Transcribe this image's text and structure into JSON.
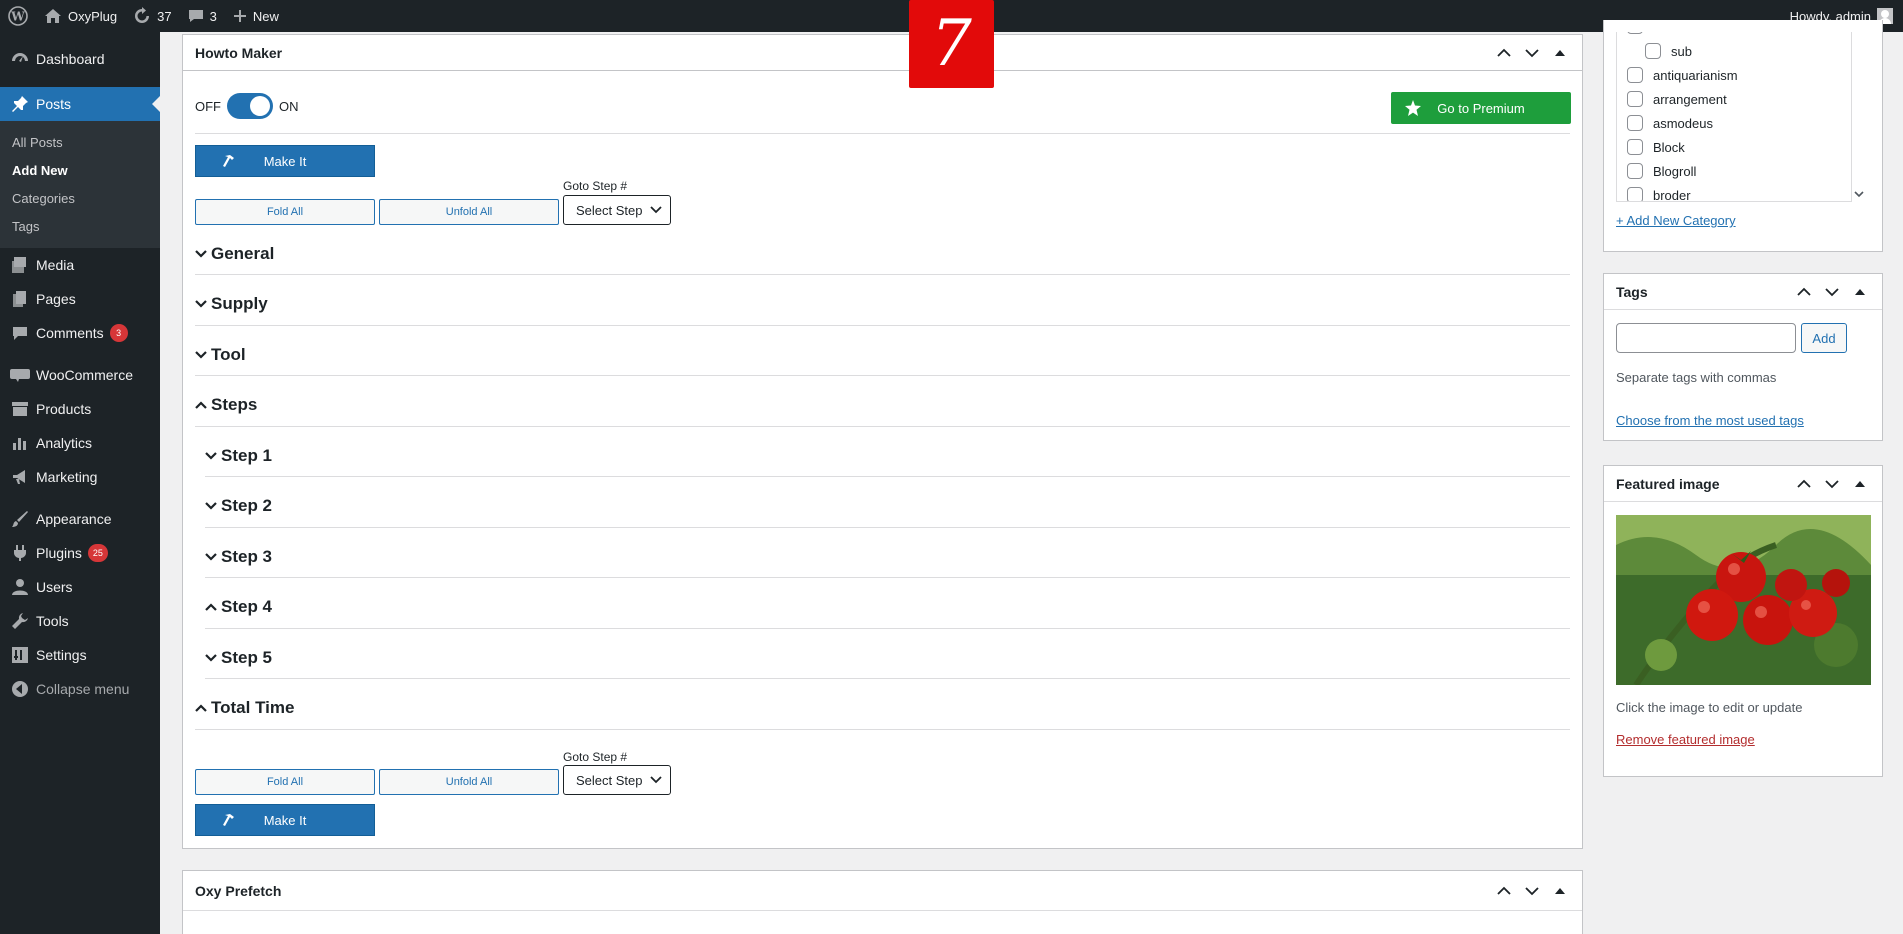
{
  "adminbar": {
    "site_name": "OxyPlug",
    "updates_count": "37",
    "comments_count": "3",
    "new_label": "New",
    "greeting": "Howdy, admin"
  },
  "sidebar": {
    "items": [
      {
        "label": "Dashboard",
        "icon": "dashboard-icon"
      },
      {
        "label": "Posts",
        "icon": "pin-icon"
      },
      {
        "label": "Media",
        "icon": "media-icon"
      },
      {
        "label": "Pages",
        "icon": "pages-icon"
      },
      {
        "label": "Comments",
        "icon": "comment-icon",
        "badge": "3"
      },
      {
        "label": "WooCommerce",
        "icon": "woo-icon"
      },
      {
        "label": "Products",
        "icon": "archive-icon"
      },
      {
        "label": "Analytics",
        "icon": "chart-icon"
      },
      {
        "label": "Marketing",
        "icon": "megaphone-icon"
      },
      {
        "label": "Appearance",
        "icon": "brush-icon"
      },
      {
        "label": "Plugins",
        "icon": "plugin-icon",
        "badge": "25"
      },
      {
        "label": "Users",
        "icon": "users-icon"
      },
      {
        "label": "Tools",
        "icon": "wrench-icon"
      },
      {
        "label": "Settings",
        "icon": "settings-icon"
      },
      {
        "label": "Collapse menu",
        "icon": "collapse-icon"
      }
    ],
    "posts_submenu": [
      "All Posts",
      "Add New",
      "Categories",
      "Tags"
    ]
  },
  "howto": {
    "title": "Howto Maker",
    "toggle_off": "OFF",
    "toggle_on": "ON",
    "toggle_state": "on",
    "premium_label": "Go to Premium",
    "make_it": "Make It",
    "fold_all": "Fold All",
    "unfold_all": "Unfold All",
    "goto_label": "Goto Step #",
    "select_step": "Select Step",
    "sections": [
      {
        "label": "General",
        "open": false
      },
      {
        "label": "Supply",
        "open": false
      },
      {
        "label": "Tool",
        "open": false
      },
      {
        "label": "Steps",
        "open": true
      },
      {
        "label": "Step 1",
        "open": false
      },
      {
        "label": "Step 2",
        "open": false
      },
      {
        "label": "Step 3",
        "open": false
      },
      {
        "label": "Step 4",
        "open": true
      },
      {
        "label": "Step 5",
        "open": false
      },
      {
        "label": "Total Time",
        "open": true
      }
    ]
  },
  "notification": {
    "number": "7",
    "color": "#e20a0a"
  },
  "prefetch": {
    "title": "Oxy Prefetch"
  },
  "categories": {
    "items": [
      "sub",
      "antiquarianism",
      "arrangement",
      "asmodeus",
      "Block",
      "Blogroll",
      "broder"
    ],
    "add_new": "+ Add New Category"
  },
  "tags": {
    "title": "Tags",
    "add_label": "Add",
    "hint": "Separate tags with commas",
    "choose_link": "Choose from the most used tags"
  },
  "featured": {
    "title": "Featured image",
    "image_subject": "tomatoes-on-vine",
    "hint": "Click the image to edit or update",
    "remove_link": "Remove featured image"
  },
  "colors": {
    "primary": "#2271b1",
    "premium": "#1e9e3c",
    "sidebar": "#1d2327",
    "badge": "#d63638"
  }
}
